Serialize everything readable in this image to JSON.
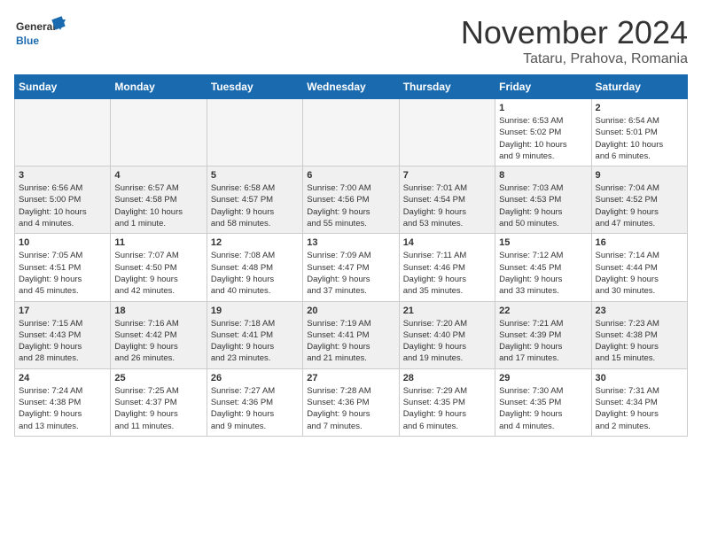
{
  "logo": {
    "line1": "General",
    "line2": "Blue"
  },
  "title": "November 2024",
  "location": "Tataru, Prahova, Romania",
  "days_of_week": [
    "Sunday",
    "Monday",
    "Tuesday",
    "Wednesday",
    "Thursday",
    "Friday",
    "Saturday"
  ],
  "weeks": [
    [
      {
        "day": "",
        "info": ""
      },
      {
        "day": "",
        "info": ""
      },
      {
        "day": "",
        "info": ""
      },
      {
        "day": "",
        "info": ""
      },
      {
        "day": "",
        "info": ""
      },
      {
        "day": "1",
        "info": "Sunrise: 6:53 AM\nSunset: 5:02 PM\nDaylight: 10 hours\nand 9 minutes."
      },
      {
        "day": "2",
        "info": "Sunrise: 6:54 AM\nSunset: 5:01 PM\nDaylight: 10 hours\nand 6 minutes."
      }
    ],
    [
      {
        "day": "3",
        "info": "Sunrise: 6:56 AM\nSunset: 5:00 PM\nDaylight: 10 hours\nand 4 minutes."
      },
      {
        "day": "4",
        "info": "Sunrise: 6:57 AM\nSunset: 4:58 PM\nDaylight: 10 hours\nand 1 minute."
      },
      {
        "day": "5",
        "info": "Sunrise: 6:58 AM\nSunset: 4:57 PM\nDaylight: 9 hours\nand 58 minutes."
      },
      {
        "day": "6",
        "info": "Sunrise: 7:00 AM\nSunset: 4:56 PM\nDaylight: 9 hours\nand 55 minutes."
      },
      {
        "day": "7",
        "info": "Sunrise: 7:01 AM\nSunset: 4:54 PM\nDaylight: 9 hours\nand 53 minutes."
      },
      {
        "day": "8",
        "info": "Sunrise: 7:03 AM\nSunset: 4:53 PM\nDaylight: 9 hours\nand 50 minutes."
      },
      {
        "day": "9",
        "info": "Sunrise: 7:04 AM\nSunset: 4:52 PM\nDaylight: 9 hours\nand 47 minutes."
      }
    ],
    [
      {
        "day": "10",
        "info": "Sunrise: 7:05 AM\nSunset: 4:51 PM\nDaylight: 9 hours\nand 45 minutes."
      },
      {
        "day": "11",
        "info": "Sunrise: 7:07 AM\nSunset: 4:50 PM\nDaylight: 9 hours\nand 42 minutes."
      },
      {
        "day": "12",
        "info": "Sunrise: 7:08 AM\nSunset: 4:48 PM\nDaylight: 9 hours\nand 40 minutes."
      },
      {
        "day": "13",
        "info": "Sunrise: 7:09 AM\nSunset: 4:47 PM\nDaylight: 9 hours\nand 37 minutes."
      },
      {
        "day": "14",
        "info": "Sunrise: 7:11 AM\nSunset: 4:46 PM\nDaylight: 9 hours\nand 35 minutes."
      },
      {
        "day": "15",
        "info": "Sunrise: 7:12 AM\nSunset: 4:45 PM\nDaylight: 9 hours\nand 33 minutes."
      },
      {
        "day": "16",
        "info": "Sunrise: 7:14 AM\nSunset: 4:44 PM\nDaylight: 9 hours\nand 30 minutes."
      }
    ],
    [
      {
        "day": "17",
        "info": "Sunrise: 7:15 AM\nSunset: 4:43 PM\nDaylight: 9 hours\nand 28 minutes."
      },
      {
        "day": "18",
        "info": "Sunrise: 7:16 AM\nSunset: 4:42 PM\nDaylight: 9 hours\nand 26 minutes."
      },
      {
        "day": "19",
        "info": "Sunrise: 7:18 AM\nSunset: 4:41 PM\nDaylight: 9 hours\nand 23 minutes."
      },
      {
        "day": "20",
        "info": "Sunrise: 7:19 AM\nSunset: 4:41 PM\nDaylight: 9 hours\nand 21 minutes."
      },
      {
        "day": "21",
        "info": "Sunrise: 7:20 AM\nSunset: 4:40 PM\nDaylight: 9 hours\nand 19 minutes."
      },
      {
        "day": "22",
        "info": "Sunrise: 7:21 AM\nSunset: 4:39 PM\nDaylight: 9 hours\nand 17 minutes."
      },
      {
        "day": "23",
        "info": "Sunrise: 7:23 AM\nSunset: 4:38 PM\nDaylight: 9 hours\nand 15 minutes."
      }
    ],
    [
      {
        "day": "24",
        "info": "Sunrise: 7:24 AM\nSunset: 4:38 PM\nDaylight: 9 hours\nand 13 minutes."
      },
      {
        "day": "25",
        "info": "Sunrise: 7:25 AM\nSunset: 4:37 PM\nDaylight: 9 hours\nand 11 minutes."
      },
      {
        "day": "26",
        "info": "Sunrise: 7:27 AM\nSunset: 4:36 PM\nDaylight: 9 hours\nand 9 minutes."
      },
      {
        "day": "27",
        "info": "Sunrise: 7:28 AM\nSunset: 4:36 PM\nDaylight: 9 hours\nand 7 minutes."
      },
      {
        "day": "28",
        "info": "Sunrise: 7:29 AM\nSunset: 4:35 PM\nDaylight: 9 hours\nand 6 minutes."
      },
      {
        "day": "29",
        "info": "Sunrise: 7:30 AM\nSunset: 4:35 PM\nDaylight: 9 hours\nand 4 minutes."
      },
      {
        "day": "30",
        "info": "Sunrise: 7:31 AM\nSunset: 4:34 PM\nDaylight: 9 hours\nand 2 minutes."
      }
    ]
  ]
}
